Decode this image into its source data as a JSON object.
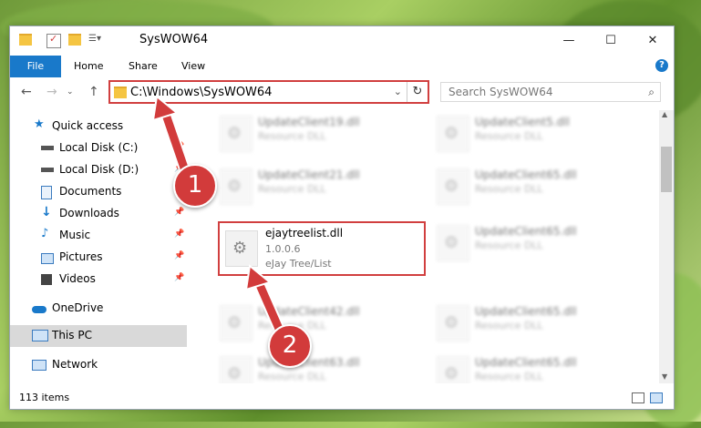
{
  "window": {
    "title": "SysWOW64",
    "controls": {
      "minimize": "—",
      "maximize": "☐",
      "close": "✕"
    }
  },
  "ribbon": {
    "tabs": [
      "File",
      "Home",
      "Share",
      "View"
    ],
    "help": "?"
  },
  "address": {
    "path": "C:\\Windows\\SysWOW64",
    "dropdown": "⌄",
    "refresh": "↻"
  },
  "search": {
    "placeholder": "Search SysWOW64"
  },
  "sidebar": {
    "items": [
      {
        "label": "Quick access",
        "icon": "star-icon"
      },
      {
        "label": "Local Disk (C:)",
        "icon": "drive-icon"
      },
      {
        "label": "Local Disk (D:)",
        "icon": "drive-icon"
      },
      {
        "label": "Documents",
        "icon": "documents-icon"
      },
      {
        "label": "Downloads",
        "icon": "download-icon"
      },
      {
        "label": "Music",
        "icon": "music-icon"
      },
      {
        "label": "Pictures",
        "icon": "pictures-icon"
      },
      {
        "label": "Videos",
        "icon": "videos-icon"
      },
      {
        "label": "OneDrive",
        "icon": "cloud-icon"
      },
      {
        "label": "This PC",
        "icon": "computer-icon"
      },
      {
        "label": "Network",
        "icon": "network-icon"
      }
    ]
  },
  "files": {
    "col1": [
      {
        "name": "UpdateClient19.dll",
        "type": "Resource DLL"
      },
      {
        "name": "UpdateClient21.dll",
        "type": "Resource DLL"
      },
      {
        "name": "ejaytreelist.dll",
        "version": "1.0.0.6",
        "type": "eJay Tree/List"
      },
      {
        "name": "UpdateClient42.dll",
        "type": "Resource DLL"
      },
      {
        "name": "UpdateClient63.dll",
        "type": "Resource DLL"
      }
    ],
    "col2": [
      {
        "name": "UpdateClient5.dll",
        "type": "Resource DLL"
      },
      {
        "name": "UpdateClient65.dll",
        "type": "Resource DLL"
      },
      {
        "name": "UpdateClient65.dll",
        "type": "Resource DLL"
      },
      {
        "name": "UpdateClient65.dll",
        "type": "Resource DLL"
      },
      {
        "name": "UpdateClient65.dll",
        "type": "Resource DLL"
      }
    ]
  },
  "status": {
    "items": "113 items"
  },
  "callouts": {
    "one": "1",
    "two": "2"
  },
  "colors": {
    "accent": "#1979ca",
    "highlight": "#d13f3f",
    "callout": "#d23b3b"
  }
}
